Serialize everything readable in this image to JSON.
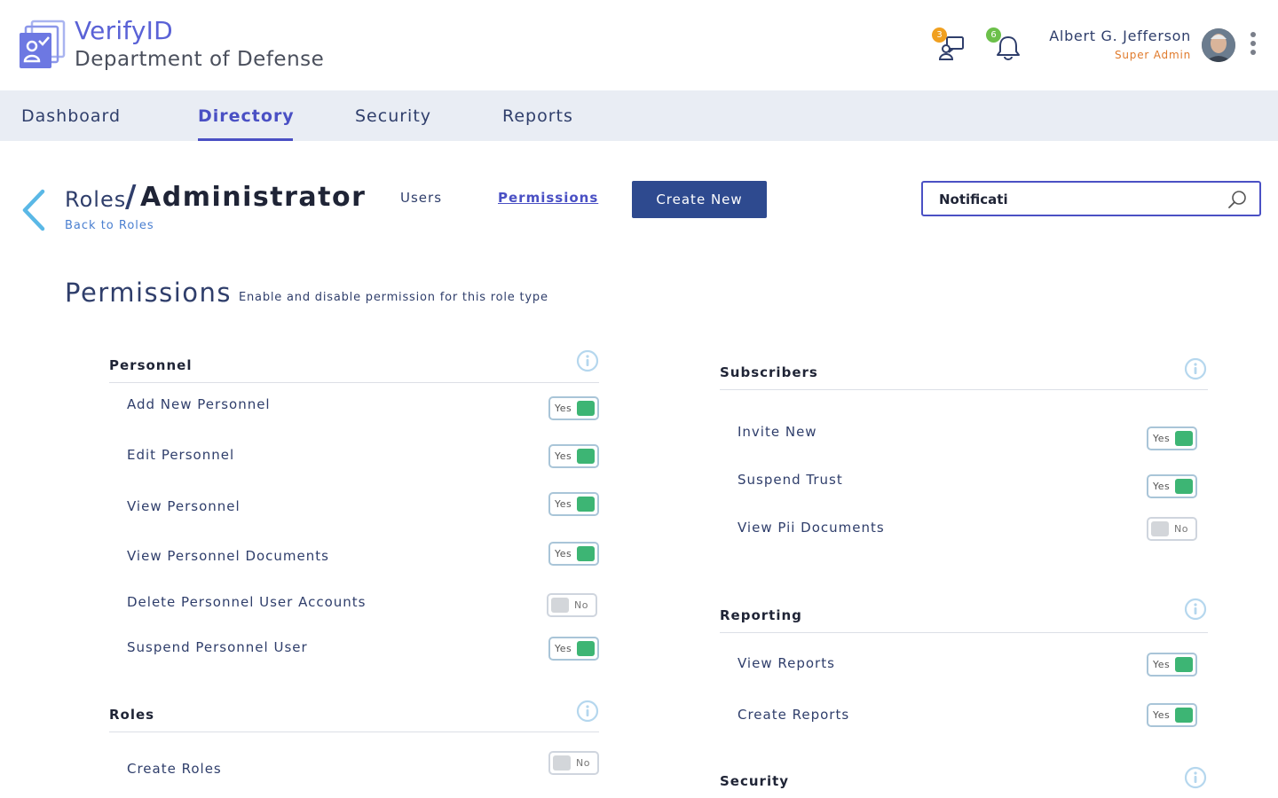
{
  "header": {
    "brand": "VerifyID",
    "org": "Department of Defense",
    "messages_badge": "3",
    "notifications_badge": "6",
    "user_name": "Albert G. Jefferson",
    "user_role": "Super Admin",
    "colors": {
      "brand": "#5a62d6",
      "messages_badge": "#f0a020",
      "notifications_badge": "#6cc04a",
      "role": "#e07a2b"
    }
  },
  "nav": {
    "items": [
      {
        "label": "Dashboard"
      },
      {
        "label": "Directory"
      },
      {
        "label": "Security"
      },
      {
        "label": "Reports"
      }
    ],
    "active": "Directory"
  },
  "breadcrumb": {
    "parent": "Roles",
    "separator": "/",
    "current": "Administrator",
    "back_label": "Back to Roles"
  },
  "subnav": {
    "users_label": "Users",
    "permissions_label": "Permissions"
  },
  "create_button": "Create New",
  "search": {
    "value": "Notificati"
  },
  "page": {
    "title": "Permissions",
    "subtitle": "Enable and disable permission for this role type"
  },
  "sections": {
    "personnel": {
      "title": "Personnel",
      "items": [
        {
          "label": "Add New Personnel",
          "state": "Yes"
        },
        {
          "label": "Edit Personnel",
          "state": "Yes"
        },
        {
          "label": "View Personnel",
          "state": "Yes"
        },
        {
          "label": "View Personnel Documents",
          "state": "Yes"
        },
        {
          "label": "Delete Personnel User Accounts",
          "state": "No"
        },
        {
          "label": "Suspend Personnel User",
          "state": "Yes"
        }
      ]
    },
    "roles": {
      "title": "Roles",
      "items": [
        {
          "label": "Create Roles",
          "state": "No"
        }
      ]
    },
    "subscribers": {
      "title": "Subscribers",
      "items": [
        {
          "label": "Invite New",
          "state": "Yes"
        },
        {
          "label": "Suspend Trust",
          "state": "Yes"
        },
        {
          "label": "View Pii Documents",
          "state": "No"
        }
      ]
    },
    "reporting": {
      "title": "Reporting",
      "items": [
        {
          "label": "View Reports",
          "state": "Yes"
        },
        {
          "label": "Create Reports",
          "state": "Yes"
        }
      ]
    },
    "security": {
      "title": "Security"
    }
  }
}
